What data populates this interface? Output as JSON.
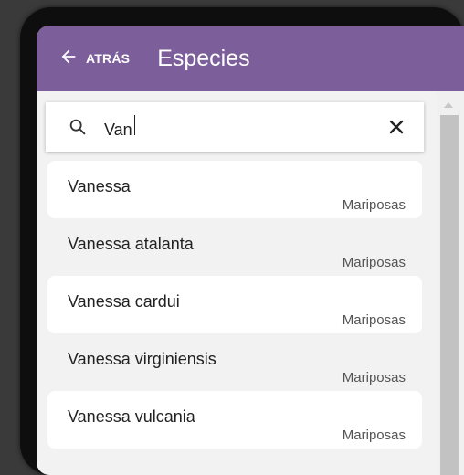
{
  "header": {
    "back_label": "ATRÁS",
    "title": "Especies"
  },
  "search": {
    "value": "Van"
  },
  "colors": {
    "appbar": "#7b5e9a",
    "item_alt_bg": "#ffffff",
    "list_bg": "#f2f2f2"
  },
  "icons": {
    "back": "arrow-left-icon",
    "search": "search-icon",
    "clear": "close-icon"
  },
  "results": [
    {
      "name": "Vanessa",
      "group": "Mariposas"
    },
    {
      "name": "Vanessa atalanta",
      "group": "Mariposas"
    },
    {
      "name": "Vanessa cardui",
      "group": "Mariposas"
    },
    {
      "name": "Vanessa virginiensis",
      "group": "Mariposas"
    },
    {
      "name": "Vanessa vulcania",
      "group": "Mariposas"
    }
  ]
}
